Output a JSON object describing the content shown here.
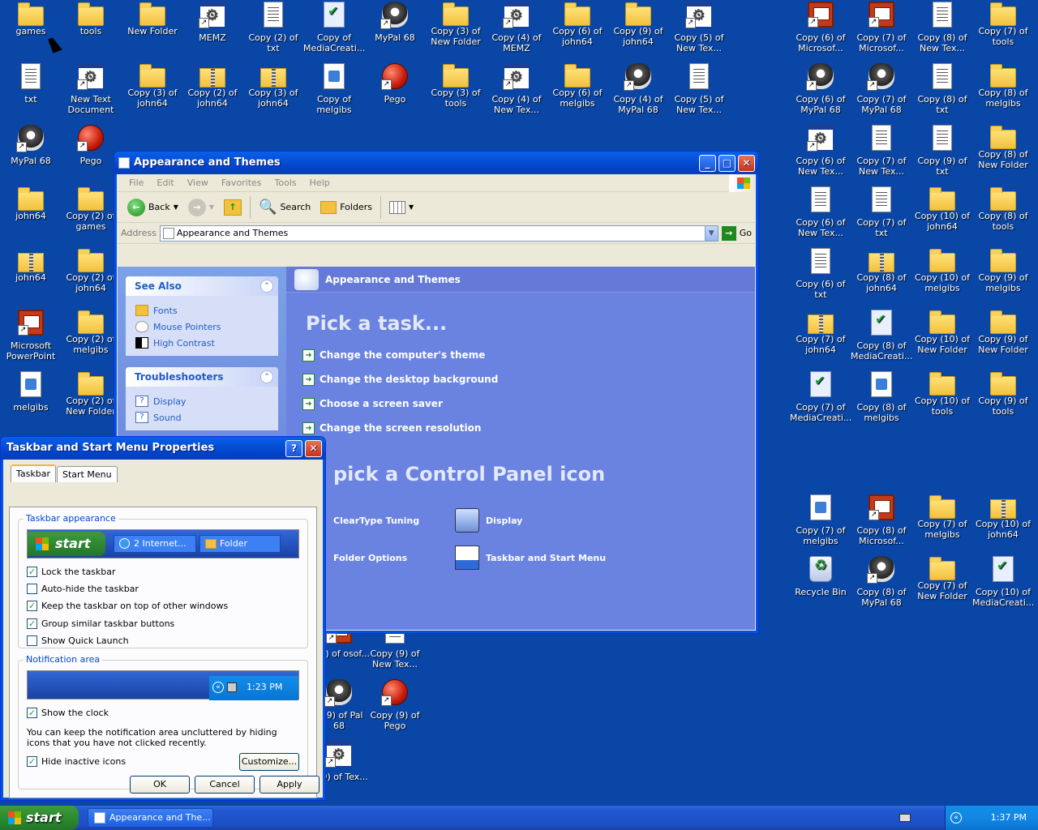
{
  "desktop": {
    "icons": [
      {
        "label": "games",
        "type": "folder",
        "x": 0,
        "y": 0
      },
      {
        "label": "tools",
        "type": "folder"
      },
      {
        "label": "New Folder",
        "type": "folder"
      },
      {
        "label": "MEMZ",
        "type": "window"
      },
      {
        "label": "Copy (2) of txt",
        "type": "txt"
      },
      {
        "label": "Copy of MediaCreati...",
        "type": "media"
      },
      {
        "label": "MyPal 68",
        "type": "raccoon"
      },
      {
        "label": "Copy (3) of New Folder",
        "type": "folder"
      },
      {
        "label": "Copy (4) of MEMZ",
        "type": "window"
      },
      {
        "label": "Copy (6) of john64",
        "type": "folder"
      },
      {
        "label": "Copy (9) of john64",
        "type": "folder"
      },
      {
        "label": "Copy (5) of New Tex...",
        "type": "window"
      },
      {
        "label": "txt",
        "type": "txt"
      },
      {
        "label": "New Text Document",
        "type": "window"
      },
      {
        "label": "Copy (3) of john64",
        "type": "folder"
      },
      {
        "label": "Copy (2) of john64",
        "type": "zip"
      },
      {
        "label": "Copy (3) of john64",
        "type": "zip"
      },
      {
        "label": "Copy of melgibs",
        "type": "doc"
      },
      {
        "label": "Pego",
        "type": "pego"
      },
      {
        "label": "Copy (3) of tools",
        "type": "folder"
      },
      {
        "label": "Copy (4) of New Tex...",
        "type": "window"
      },
      {
        "label": "Copy (6) of melgibs",
        "type": "folder"
      },
      {
        "label": "Copy (4) of MyPal 68",
        "type": "raccoon"
      },
      {
        "label": "Copy (5) of New Tex...",
        "type": "txt"
      },
      {
        "label": "MyPal 68",
        "type": "raccoon"
      },
      {
        "label": "Pego",
        "type": "pego"
      },
      {
        "label": "john64",
        "type": "folder"
      },
      {
        "label": "Copy (2) of games",
        "type": "folder"
      },
      {
        "label": "john64",
        "type": "zip"
      },
      {
        "label": "Copy (2) of john64",
        "type": "folder"
      },
      {
        "label": "Microsoft PowerPoint",
        "type": "ppt"
      },
      {
        "label": "Copy (2) of melgibs",
        "type": "folder"
      },
      {
        "label": "melgibs",
        "type": "doc"
      },
      {
        "label": "Copy (2) of New Folder",
        "type": "folder"
      },
      {
        "label": "Copy (6) of Microsof...",
        "type": "ppt"
      },
      {
        "label": "Copy (7) of Microsof...",
        "type": "ppt"
      },
      {
        "label": "Copy (8) of New Tex...",
        "type": "txt"
      },
      {
        "label": "Copy (7) of tools",
        "type": "folder"
      },
      {
        "label": "Copy (6) of MyPal 68",
        "type": "raccoon"
      },
      {
        "label": "Copy (7) of MyPal 68",
        "type": "raccoon"
      },
      {
        "label": "Copy (8) of txt",
        "type": "txt"
      },
      {
        "label": "Copy (8) of melgibs",
        "type": "folder"
      },
      {
        "label": "Copy (6) of New Tex...",
        "type": "window"
      },
      {
        "label": "Copy (7) of New Tex...",
        "type": "txt"
      },
      {
        "label": "Copy (9) of txt",
        "type": "txt"
      },
      {
        "label": "Copy (8) of New Folder",
        "type": "folder"
      },
      {
        "label": "Copy (6) of New Tex...",
        "type": "txt"
      },
      {
        "label": "Copy (7) of txt",
        "type": "txt"
      },
      {
        "label": "Copy (10) of john64",
        "type": "folder"
      },
      {
        "label": "Copy (8) of tools",
        "type": "folder"
      },
      {
        "label": "Copy (6) of txt",
        "type": "txt"
      },
      {
        "label": "Copy (8) of john64",
        "type": "zip"
      },
      {
        "label": "Copy (10) of melgibs",
        "type": "folder"
      },
      {
        "label": "Copy (9) of melgibs",
        "type": "folder"
      },
      {
        "label": "Copy (7) of john64",
        "type": "zip"
      },
      {
        "label": "Copy (8) of MediaCreati...",
        "type": "media"
      },
      {
        "label": "Copy (10) of New Folder",
        "type": "folder"
      },
      {
        "label": "Copy (9) of New Folder",
        "type": "folder"
      },
      {
        "label": "Copy (7) of MediaCreati...",
        "type": "media"
      },
      {
        "label": "Copy (8) of melgibs",
        "type": "doc"
      },
      {
        "label": "Copy (10) of tools",
        "type": "folder"
      },
      {
        "label": "Copy (9) of tools",
        "type": "folder"
      },
      {
        "label": "Copy (7) of melgibs",
        "type": "doc"
      },
      {
        "label": "Copy (8) of Microsof...",
        "type": "ppt"
      },
      {
        "label": "Copy (7) of melgibs",
        "type": "folder"
      },
      {
        "label": "Copy (10) of john64",
        "type": "zip"
      },
      {
        "label": "Recycle Bin",
        "type": "recycle"
      },
      {
        "label": "Copy (8) of MyPal 68",
        "type": "raccoon"
      },
      {
        "label": "Copy (7) of New Folder",
        "type": "folder"
      },
      {
        "label": "Copy (10) of MediaCreati...",
        "type": "media"
      },
      {
        "label": "y (9) of osof...",
        "type": "ppt"
      },
      {
        "label": "Copy (9) of New Tex...",
        "type": "txt"
      },
      {
        "label": "y (9) of Pal 68",
        "type": "raccoon"
      },
      {
        "label": "Copy (9) of Pego",
        "type": "pego"
      },
      {
        "label": "y (9) of Tex...",
        "type": "window"
      }
    ]
  },
  "cp_window": {
    "title": "Appearance and Themes",
    "menu": [
      "File",
      "Edit",
      "View",
      "Favorites",
      "Tools",
      "Help"
    ],
    "toolbar": {
      "back": "Back",
      "search": "Search",
      "folders": "Folders"
    },
    "address_label": "Address",
    "address_value": "Appearance and Themes",
    "go": "Go",
    "see_also": {
      "title": "See Also",
      "items": [
        "Fonts",
        "Mouse Pointers",
        "High Contrast"
      ]
    },
    "troubleshooters": {
      "title": "Troubleshooters",
      "items": [
        "Display",
        "Sound"
      ]
    },
    "header": "Appearance and Themes",
    "pick_task": "Pick a task...",
    "tasks": [
      "Change the computer's theme",
      "Change the desktop background",
      "Choose a screen saver",
      "Change the screen resolution"
    ],
    "pick_icon": "pick a Control Panel icon",
    "icons": [
      "ClearType Tuning",
      "Display",
      "Folder Options",
      "Taskbar and Start Menu"
    ]
  },
  "tp_dialog": {
    "title": "Taskbar and Start Menu Properties",
    "help": "?",
    "tabs": [
      "Taskbar",
      "Start Menu"
    ],
    "taskbar_appearance": "Taskbar appearance",
    "preview_start": "start",
    "preview_task1": "2 Internet...",
    "preview_task2": "Folder",
    "options": [
      {
        "label": "Lock the taskbar",
        "checked": true
      },
      {
        "label": "Auto-hide the taskbar",
        "checked": false
      },
      {
        "label": "Keep the taskbar on top of other windows",
        "checked": true
      },
      {
        "label": "Group similar taskbar buttons",
        "checked": true
      },
      {
        "label": "Show Quick Launch",
        "checked": false
      }
    ],
    "notification_area": "Notification area",
    "preview_time": "1:23 PM",
    "show_clock": "Show the clock",
    "show_clock_checked": true,
    "description": "You can keep the notification area uncluttered by hiding icons that you have not clicked recently.",
    "hide_inactive": "Hide inactive icons",
    "hide_inactive_checked": true,
    "customize": "Customize...",
    "ok": "OK",
    "cancel": "Cancel",
    "apply": "Apply"
  },
  "taskbar": {
    "start": "start",
    "task": "Appearance and The...",
    "clock": "1:37 PM"
  }
}
